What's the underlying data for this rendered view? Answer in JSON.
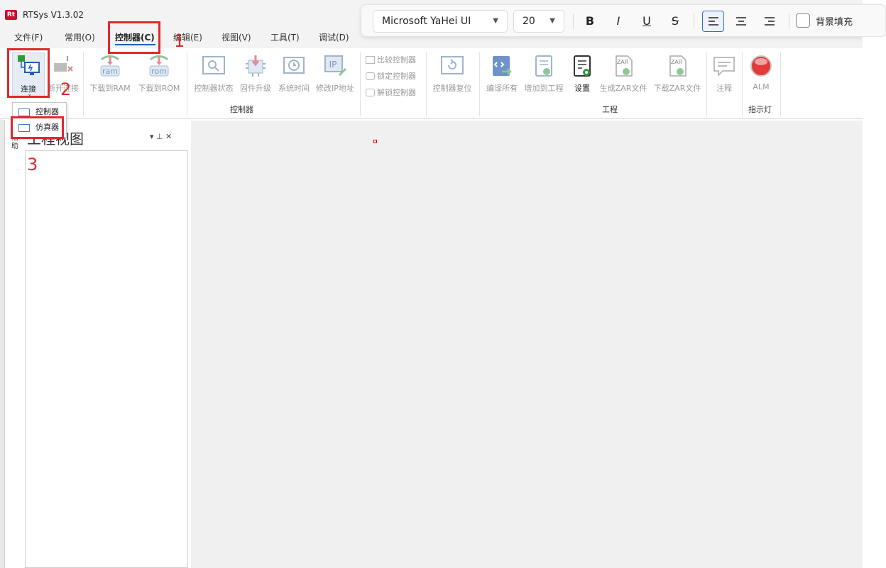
{
  "window": {
    "logo": "Rt",
    "title": "RTSys V1.3.02"
  },
  "menu": [
    {
      "label": "文件(F)"
    },
    {
      "label": "常用(O)"
    },
    {
      "label": "控制器(C)"
    },
    {
      "label": "编辑(E)"
    },
    {
      "label": "视图(V)"
    },
    {
      "label": "工具(T)"
    },
    {
      "label": "调试(D)"
    }
  ],
  "ribbon": {
    "connect": "连接",
    "connect_chevron": "⌄",
    "disconnect": "断开连接",
    "download_ram": "下载到RAM",
    "ram_icon": "ram",
    "download_rom": "下载到ROM",
    "rom_icon": "rom",
    "controller_status": "控制器状态",
    "firmware_upgrade": "固件升级",
    "system_time": "系统时间",
    "modify_ip": "修改IP地址",
    "ip_icon": "IP",
    "compare_controller": "比较控制器",
    "lock_controller": "锁定控制器",
    "unlock_controller": "解锁控制器",
    "controller_reset": "控制器复位",
    "compile_all": "编译所有",
    "add_to_project": "增加到工程",
    "settings": "设置",
    "generate_zar": "生成ZAR文件",
    "download_zar": "下载ZAR文件",
    "zar_icon": "ZAR",
    "comment": "注释",
    "alm": "ALM",
    "group_controller": "控制器",
    "group_project": "工程",
    "group_indicator": "指示灯"
  },
  "fontbar": {
    "font_family": "Microsoft YaHei UI",
    "font_size": "20",
    "bold": "B",
    "italic": "I",
    "underline": "U",
    "strike": "S",
    "fill_label": "背景填充",
    "fill_checked": false
  },
  "dropdown": {
    "items": [
      {
        "label": "控制器"
      },
      {
        "label": "仿真器"
      }
    ]
  },
  "panel": {
    "side_tab": "帮助",
    "title": "工程视图",
    "controls": "▾ ⊥ ✕"
  },
  "annotations": {
    "n1": "1",
    "n2": "2",
    "n3": "3"
  },
  "colors": {
    "annotation": "#e0282e",
    "accent": "#1f5fbf"
  }
}
